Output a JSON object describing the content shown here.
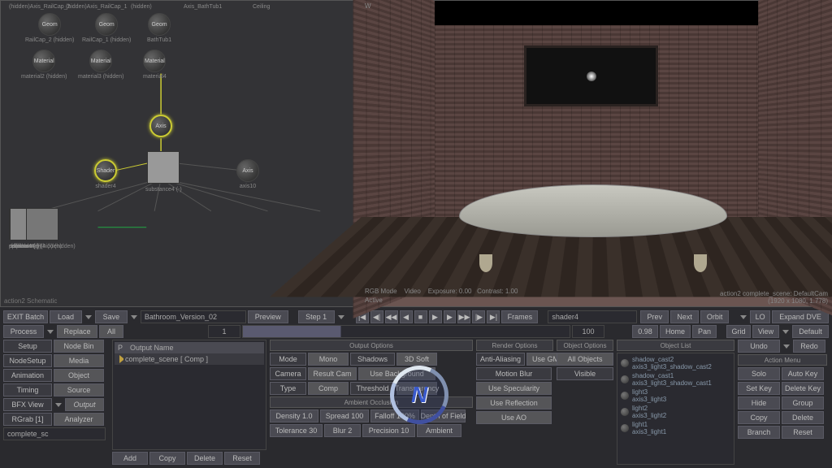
{
  "schematic": {
    "top_nodes": [
      {
        "top": "(hidden)Axis_RailCap_2",
        "geom": "Geom",
        "geom_label": "RailCap_2 (hidden)",
        "mat": "Material",
        "mat_label": "material2 (hidden)"
      },
      {
        "top": "(hidden)Axis_RailCap_1",
        "geom": "Geom",
        "geom_label": "RailCap_1 (hidden)",
        "mat": "Material",
        "mat_label": "material3 (hidden)"
      },
      {
        "top": "(hidden)",
        "geom": "Geom",
        "geom_label": "BathTub1",
        "mat": "Material",
        "mat_label": "material4"
      },
      {
        "top": "Axis_BathTub1",
        "geom": "",
        "geom_label": "",
        "mat": "",
        "mat_label": ""
      },
      {
        "top": "Ceiling",
        "geom": "",
        "geom_label": "",
        "mat": "",
        "mat_label": ""
      }
    ],
    "axis_mid": "Axis",
    "shader": "Shader",
    "shader_label": "shader4",
    "substance_label": "substance4 (-)",
    "axis_right": "Axis",
    "axis_right_label": "axis10",
    "swatches": [
      {
        "label": "specular4 (-)",
        "bg": "#1a1a1a"
      },
      {
        "label": "normal4 (-)",
        "bg": "#7070b8"
      },
      {
        "label": "diffuse4 (-)",
        "bg": "#888888"
      },
      {
        "label": "parallax4 (-) (hidden)",
        "bg": "#666666"
      },
      {
        "label": "reflection4 (-)",
        "bg": "#888888"
      },
      {
        "label": "displacement4 (-) (hidden)",
        "bg": "#777777"
      }
    ],
    "footer": "action2 Schematic"
  },
  "viewport": {
    "tl": "W",
    "bl_line1": "RGB Mode",
    "bl_line2": "Active",
    "bl_video": "Video",
    "bl_exposure": "Exposure: 0.00",
    "bl_contrast": "Contrast: 1.00",
    "br_line1": "action2 complete_scene: DefaultCam",
    "br_line2": "(1920 x 1080, 1.778)"
  },
  "toolbar": {
    "exit": "EXIT Batch",
    "load": "Load",
    "save": "Save",
    "scene": "Bathroom_Version_02",
    "preview": "Preview",
    "step": "Step 1",
    "frames": "Frames",
    "current": "shader4",
    "prev": "Prev",
    "next": "Next",
    "orbit": "Orbit",
    "lo": "LO",
    "expand": "Expand DVE",
    "zoom": "0.98",
    "home": "Home",
    "pan": "Pan",
    "process": "Process",
    "replace": "Replace",
    "all": "All",
    "frame_start": "1",
    "frame_end": "100",
    "grid": "Grid",
    "view": "View",
    "default": "Default"
  },
  "left_tabs": {
    "setup": "Setup",
    "nodebin": "Node Bin",
    "nodesetup": "NodeSetup",
    "media": "Media",
    "animation": "Animation",
    "object": "Object",
    "timing": "Timing",
    "source": "Source",
    "bfxview": "BFX View",
    "output": "Output",
    "rgrab": "RGrab [1]",
    "analyzer": "Analyzer",
    "scene": "complete_sc",
    "add": "Add",
    "copy": "Copy",
    "delete": "Delete",
    "reset": "Reset"
  },
  "output_panel": {
    "p": "P",
    "name_header": "Output Name",
    "item": "complete_scene [ Comp ]"
  },
  "output_options": {
    "header": "Output Options",
    "mode": "Mode",
    "mono": "Mono",
    "shadows": "Shadows",
    "soft": "3D Soft",
    "camera": "Camera",
    "resultcam": "Result Cam",
    "usebg": "Use Background",
    "type": "Type",
    "comp": "Comp",
    "threshold": "Threshold",
    "transparency": "Transparency",
    "ao_header": "Ambient Occlusion",
    "density": "Density 1.0",
    "spread": "Spread 100",
    "falloff": "Falloff 100%",
    "dof": "Depth of Field",
    "tolerance": "Tolerance 30",
    "blur": "Blur 2",
    "precision": "Precision 10",
    "ambient": "Ambient"
  },
  "render_options": {
    "header": "Render Options",
    "aa": "Anti-Aliasing",
    "gmask": "Use GMask",
    "motionblur": "Motion Blur",
    "usespec": "Use Specularity",
    "usereflect": "Use Reflection",
    "useao": "Use AO"
  },
  "object_options": {
    "header": "Object Options",
    "all": "All Objects",
    "visible": "Visible"
  },
  "object_list": {
    "header": "Object List",
    "items": [
      {
        "a": "shadow_cast2",
        "b": "axis3_light3_shadow_cast2"
      },
      {
        "a": "shadow_cast1",
        "b": "axis3_light3_shadow_cast1"
      },
      {
        "a": "light3",
        "b": "axis3_light3"
      },
      {
        "a": "light2",
        "b": "axis3_light2"
      },
      {
        "a": "light1",
        "b": "axis3_light1"
      }
    ]
  },
  "right_btns": {
    "undo": "Undo",
    "redo": "Redo",
    "action_menu": "Action Menu",
    "solo": "Solo",
    "autokey": "Auto Key",
    "setkey": "Set Key",
    "deletekey": "Delete Key",
    "hide": "Hide",
    "group": "Group",
    "copy": "Copy",
    "delete": "Delete",
    "branch": "Branch",
    "reset": "Reset"
  }
}
